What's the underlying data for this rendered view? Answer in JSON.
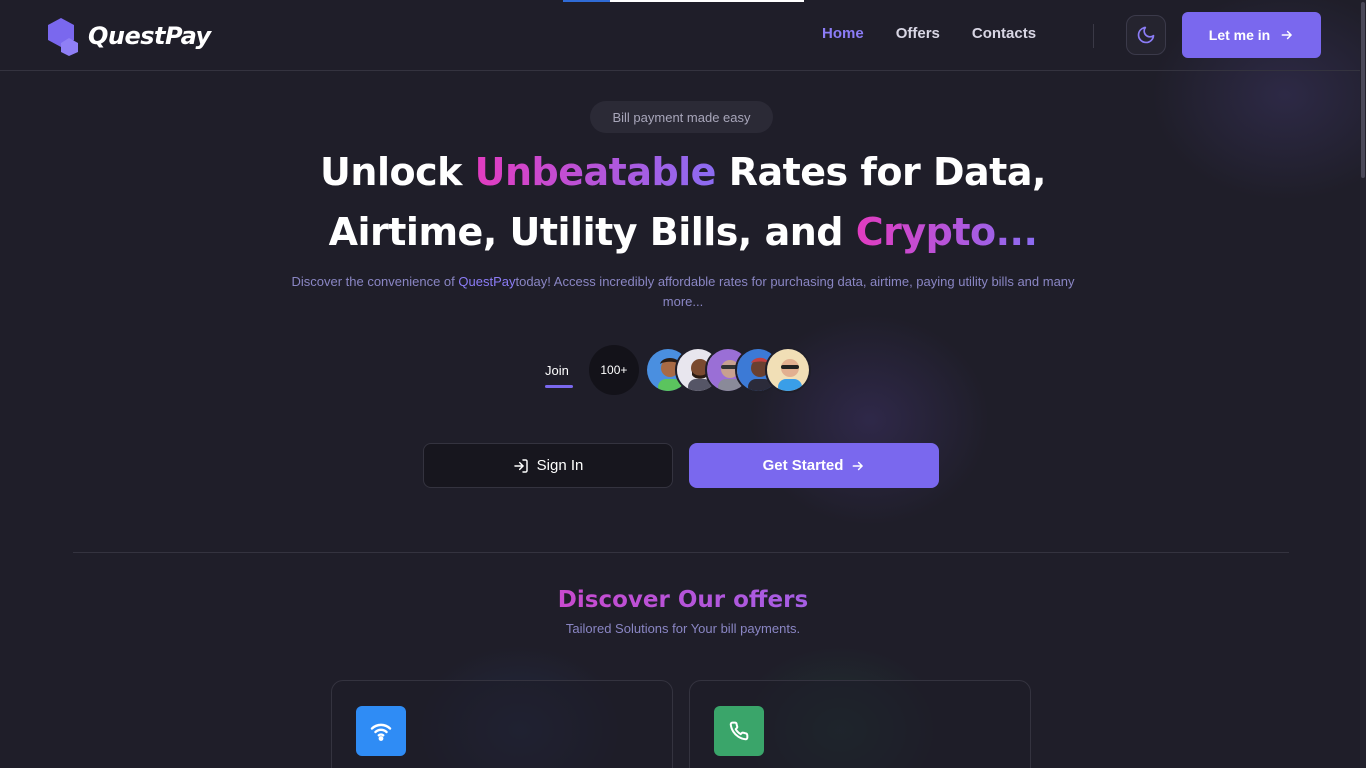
{
  "header": {
    "brand": "QuestPay",
    "nav": [
      {
        "label": "Home",
        "active": true
      },
      {
        "label": "Offers",
        "active": false
      },
      {
        "label": "Contacts",
        "active": false
      }
    ],
    "theme_icon": "moon-icon",
    "cta_label": "Let me in"
  },
  "hero": {
    "pill": "Bill payment made easy",
    "headline": {
      "part1": "Unlock ",
      "highlight1": "Unbeatable",
      "part2": " Rates for Data,",
      "part3": "Airtime, Utility Bills, and ",
      "highlight2": "Crypto..."
    },
    "subtitle": {
      "before": "Discover the convenience of ",
      "brand": "QuestPay",
      "after": "today! Access incredibly affordable rates for purchasing data, airtime, paying utility bills and many more..."
    },
    "join_label": "Join",
    "user_count": "100+",
    "signin_label": "Sign In",
    "get_started_label": "Get Started"
  },
  "offers": {
    "title": "Discover Our offers",
    "subtitle": "Tailored Solutions for Your bill payments.",
    "cards": [
      {
        "icon": "wifi-icon",
        "color": "#2f8cf5"
      },
      {
        "icon": "phone-icon",
        "color": "#3aa56a"
      }
    ]
  },
  "colors": {
    "accent": "#7a68ee",
    "background": "#1f1e29",
    "gradient_start": "#e23cc0",
    "gradient_end": "#8b6cf2"
  }
}
